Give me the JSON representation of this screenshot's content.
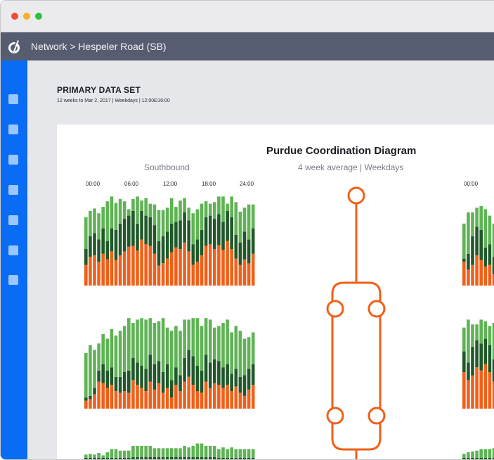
{
  "window": {
    "controls": [
      "close",
      "minimize",
      "zoom"
    ]
  },
  "app": {
    "logo_icon": "brand-logo-icon",
    "breadcrumb": "Network > Hespeler Road (SB)"
  },
  "sidebar": {
    "items": [
      {
        "icon": "nav-square-icon"
      },
      {
        "icon": "nav-square-icon"
      },
      {
        "icon": "nav-square-icon"
      },
      {
        "icon": "nav-square-icon"
      },
      {
        "icon": "nav-square-icon"
      },
      {
        "icon": "nav-square-icon"
      },
      {
        "icon": "nav-square-icon"
      }
    ],
    "color": "#0a6cf5"
  },
  "dataset": {
    "title": "PRIMARY DATA SET",
    "subtitle": "12 weeks to Mar 2, 2017 | Weekdays | 12:00Ð16:00"
  },
  "chart": {
    "title": "Purdue Coordination Diagram",
    "subtitle": "4 week average | Weekdays",
    "direction_label": "Southbound",
    "time_ticks": [
      "00:00",
      "06:00",
      "12:00",
      "18:00",
      "24:00"
    ],
    "right_time_tick": "00:00",
    "colors": {
      "light_green": "#5fb355",
      "dark_green": "#20582a",
      "orange": "#f0601a",
      "diagram": "#f0601a"
    }
  },
  "chart_data": {
    "type": "bar",
    "stacked": true,
    "series_order": [
      "orange",
      "dark_green",
      "light_green"
    ],
    "panels": [
      {
        "bars": [
          [
            0.26,
            0.46,
            0.86
          ],
          [
            0.36,
            0.62,
            0.94
          ],
          [
            0.38,
            0.66,
            0.97
          ],
          [
            0.3,
            0.58,
            0.91
          ],
          [
            0.4,
            0.72,
            0.99
          ],
          [
            0.33,
            0.56,
            1.06
          ],
          [
            0.43,
            0.72,
            1.12
          ],
          [
            0.32,
            0.7,
            1.04
          ],
          [
            0.38,
            0.78,
            1.09
          ],
          [
            0.43,
            0.84,
            1.06
          ],
          [
            0.49,
            0.88,
            0.96
          ],
          [
            0.5,
            0.94,
            1.09
          ],
          [
            0.44,
            0.78,
            1.12
          ],
          [
            0.58,
            0.94,
            1.07
          ],
          [
            0.52,
            0.88,
            1.1
          ],
          [
            0.5,
            0.86,
            1.03
          ],
          [
            0.4,
            0.76,
            1.02
          ],
          [
            0.25,
            0.56,
            0.95
          ],
          [
            0.28,
            0.62,
            0.95
          ],
          [
            0.34,
            0.68,
            0.98
          ],
          [
            0.42,
            0.78,
            1.1
          ],
          [
            0.48,
            0.8,
            0.99
          ],
          [
            0.46,
            0.82,
            1.07
          ],
          [
            0.54,
            0.92,
            1.1
          ],
          [
            0.43,
            0.82,
            0.98
          ],
          [
            0.26,
            0.52,
            0.91
          ],
          [
            0.3,
            0.58,
            0.96
          ],
          [
            0.38,
            0.7,
            1.03
          ],
          [
            0.5,
            0.86,
            1.06
          ],
          [
            0.52,
            0.88,
            1.03
          ],
          [
            0.46,
            0.84,
            1.05
          ],
          [
            0.51,
            0.9,
            1.12
          ],
          [
            0.45,
            0.8,
            1.12
          ],
          [
            0.56,
            0.94,
            1.03
          ],
          [
            0.46,
            0.86,
            1.12
          ],
          [
            0.34,
            0.64,
            1.05
          ],
          [
            0.26,
            0.54,
            0.93
          ],
          [
            0.33,
            0.68,
            0.98
          ],
          [
            0.28,
            0.58,
            1.02
          ],
          [
            0.4,
            0.72,
            1.02
          ]
        ]
      },
      {
        "bars": [
          [
            0.1,
            0.14,
            0.7
          ],
          [
            0.12,
            0.16,
            0.8
          ],
          [
            0.18,
            0.26,
            0.74
          ],
          [
            0.34,
            0.48,
            0.82
          ],
          [
            0.32,
            0.56,
            0.94
          ],
          [
            0.26,
            0.48,
            0.88
          ],
          [
            0.3,
            0.52,
            1.0
          ],
          [
            0.22,
            0.4,
            0.92
          ],
          [
            0.2,
            0.4,
            0.98
          ],
          [
            0.22,
            0.46,
            1.04
          ],
          [
            0.2,
            0.48,
            1.14
          ],
          [
            0.36,
            0.64,
            1.08
          ],
          [
            0.3,
            0.58,
            1.12
          ],
          [
            0.26,
            0.54,
            1.14
          ],
          [
            0.22,
            0.5,
            1.12
          ],
          [
            0.34,
            0.68,
            1.14
          ],
          [
            0.24,
            0.56,
            1.08
          ],
          [
            0.32,
            0.6,
            1.1
          ],
          [
            0.2,
            0.46,
            1.14
          ],
          [
            0.26,
            0.56,
            1.02
          ],
          [
            0.14,
            0.36,
            0.98
          ],
          [
            0.3,
            0.52,
            1.04
          ],
          [
            0.22,
            0.42,
            0.98
          ],
          [
            0.34,
            0.64,
            1.12
          ],
          [
            0.4,
            0.74,
            1.12
          ],
          [
            0.3,
            0.66,
            1.14
          ],
          [
            0.22,
            0.54,
            1.14
          ],
          [
            0.2,
            0.48,
            1.04
          ],
          [
            0.34,
            0.68,
            1.14
          ],
          [
            0.26,
            0.58,
            1.12
          ],
          [
            0.32,
            0.62,
            1.02
          ],
          [
            0.3,
            0.6,
            1.04
          ],
          [
            0.26,
            0.52,
            1.08
          ],
          [
            0.3,
            0.56,
            1.12
          ],
          [
            0.22,
            0.44,
            0.96
          ],
          [
            0.28,
            0.5,
            1.04
          ],
          [
            0.2,
            0.4,
            0.98
          ],
          [
            0.16,
            0.42,
            0.88
          ],
          [
            0.24,
            0.5,
            0.9
          ],
          [
            0.3,
            0.56,
            0.96
          ]
        ]
      },
      {
        "bars": [
          [
            0.05,
            0.09,
            0.13
          ],
          [
            0.05,
            0.09,
            0.14
          ],
          [
            0.05,
            0.09,
            0.13
          ],
          [
            0.05,
            0.09,
            0.15
          ],
          [
            0.05,
            0.09,
            0.12
          ],
          [
            0.05,
            0.09,
            0.16
          ],
          [
            0.05,
            0.09,
            0.2
          ],
          [
            0.05,
            0.09,
            0.2
          ],
          [
            0.05,
            0.09,
            0.18
          ],
          [
            0.05,
            0.09,
            0.18
          ],
          [
            0.05,
            0.09,
            0.18
          ],
          [
            0.05,
            0.1,
            0.24
          ],
          [
            0.05,
            0.1,
            0.24
          ],
          [
            0.05,
            0.1,
            0.24
          ],
          [
            0.05,
            0.1,
            0.24
          ],
          [
            0.05,
            0.1,
            0.24
          ],
          [
            0.05,
            0.1,
            0.21
          ],
          [
            0.05,
            0.1,
            0.21
          ],
          [
            0.05,
            0.1,
            0.21
          ],
          [
            0.05,
            0.1,
            0.21
          ],
          [
            0.05,
            0.1,
            0.21
          ],
          [
            0.05,
            0.1,
            0.21
          ],
          [
            0.05,
            0.1,
            0.21
          ],
          [
            0.05,
            0.1,
            0.24
          ],
          [
            0.05,
            0.1,
            0.22
          ],
          [
            0.05,
            0.1,
            0.24
          ],
          [
            0.05,
            0.1,
            0.27
          ],
          [
            0.05,
            0.1,
            0.27
          ],
          [
            0.05,
            0.1,
            0.24
          ],
          [
            0.05,
            0.1,
            0.24
          ],
          [
            0.05,
            0.1,
            0.24
          ],
          [
            0.05,
            0.09,
            0.2
          ],
          [
            0.05,
            0.09,
            0.22
          ],
          [
            0.05,
            0.09,
            0.2
          ],
          [
            0.05,
            0.09,
            0.22
          ],
          [
            0.05,
            0.09,
            0.2
          ],
          [
            0.05,
            0.09,
            0.2
          ],
          [
            0.05,
            0.09,
            0.2
          ],
          [
            0.05,
            0.09,
            0.2
          ],
          [
            0.05,
            0.09,
            0.2
          ]
        ]
      },
      {
        "bars": [
          [
            0.3,
            0.34,
            0.78
          ],
          [
            0.2,
            0.4,
            0.92
          ],
          [
            0.26,
            0.62,
            0.92
          ],
          [
            0.38,
            0.74,
            0.98
          ],
          [
            0.32,
            0.7,
            1.0
          ],
          [
            0.24,
            0.48,
            0.96
          ],
          [
            0.26,
            0.52,
            0.88
          ],
          [
            0.14,
            0.36,
            0.78
          ]
        ]
      },
      {
        "bars": [
          [
            0.46,
            0.72,
            1.02
          ],
          [
            0.36,
            0.58,
            1.12
          ],
          [
            0.42,
            0.78,
            1.06
          ],
          [
            0.52,
            0.86,
            1.06
          ],
          [
            0.48,
            0.82,
            1.12
          ],
          [
            0.56,
            0.88,
            1.1
          ],
          [
            0.46,
            0.8,
            1.04
          ],
          [
            0.34,
            0.62,
            1.08
          ]
        ]
      },
      {
        "bars": [
          [
            0.05,
            0.09,
            0.14
          ],
          [
            0.05,
            0.09,
            0.16
          ],
          [
            0.05,
            0.09,
            0.17
          ],
          [
            0.05,
            0.09,
            0.18
          ],
          [
            0.05,
            0.09,
            0.2
          ],
          [
            0.05,
            0.09,
            0.2
          ],
          [
            0.05,
            0.09,
            0.2
          ],
          [
            0.05,
            0.09,
            0.21
          ]
        ]
      }
    ]
  }
}
